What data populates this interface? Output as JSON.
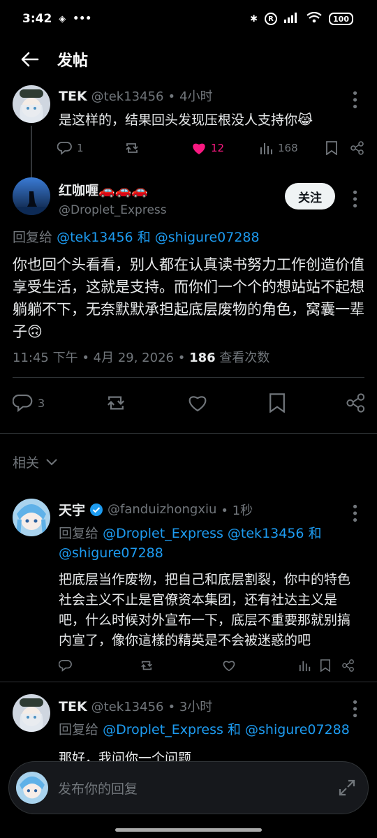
{
  "status_bar": {
    "time": "3:42",
    "battery": "100"
  },
  "header": {
    "title": "发帖"
  },
  "parent_tweet": {
    "name": "TEK",
    "handle": "@tek13456",
    "time": "4小时",
    "text": "是这样的，结果回头发现压根没人支持你😹",
    "replies": "1",
    "likes": "12",
    "views": "168"
  },
  "main_tweet": {
    "name": "红咖喱🚗🚗🚗",
    "handle": "@Droplet_Express",
    "follow_label": "关注",
    "reply_prefix": "回复给",
    "reply_to_1": "@tek13456",
    "reply_and": "和",
    "reply_to_2": "@shigure07288",
    "text": "你也回个头看看，别人都在认真读书努力工作创造价值享受生活，这就是支持。而你们一个个的想站站不起想躺躺不下，无奈默默承担起底层废物的角色，窝囊一辈子🙃",
    "meta_time": "11:45 下午 • 4月 29, 2026 •",
    "views": "186",
    "views_label": "查看次数",
    "replies": "3"
  },
  "related": {
    "label": "相关"
  },
  "reply_1": {
    "name": "天宇",
    "handle": "@fanduizhongxiu",
    "time": "• 1秒",
    "reply_prefix": "回复给",
    "reply_to": "@Droplet_Express @tek13456",
    "reply_and": "和",
    "reply_to_2": "@shigure07288",
    "text": "把底层当作废物，把自己和底层割裂，你中的特色社会主义不止是官僚资本集团，还有社达主义是吧，什么时候对外宣布一下，底层不重要那就别搞内宣了，像你這樣的精英是不会被迷惑的吧"
  },
  "reply_2": {
    "name": "TEK",
    "handle": "@tek13456",
    "time": "• 3小时",
    "reply_prefix": "回复给",
    "reply_to": "@Droplet_Express",
    "reply_and": "和",
    "reply_to_2": "@shigure07288",
    "text": "那好，我问你一个问题"
  },
  "composer": {
    "placeholder": "发布你的回复"
  }
}
